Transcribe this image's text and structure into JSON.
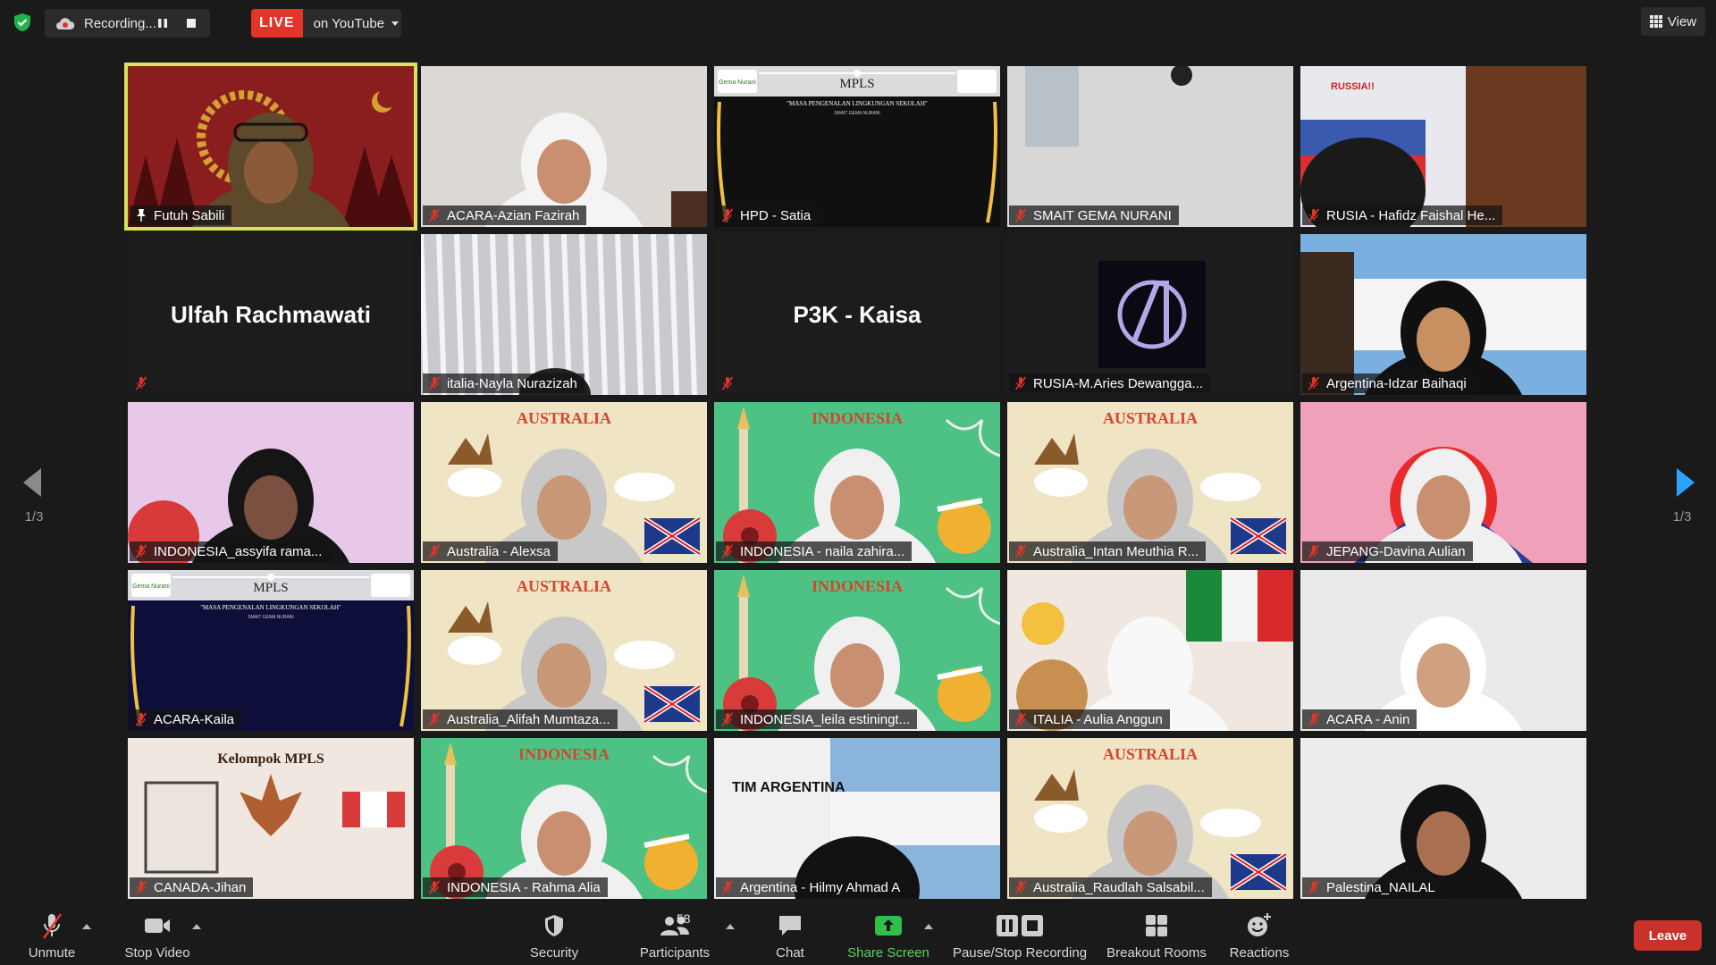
{
  "topbar": {
    "recording_label": "Recording...",
    "live_badge": "LIVE",
    "live_destination": "on YouTube",
    "view_label": "View"
  },
  "paging": {
    "left_label": "1/3",
    "right_label": "1/3"
  },
  "tiles": [
    {
      "name": "Futuh Sabili",
      "active": true,
      "scene": "red"
    },
    {
      "name": "ACARA-Azian Fazirah",
      "scene": "wall"
    },
    {
      "name": "HPD - Satia",
      "scene": "mpls-dark"
    },
    {
      "name": "SMAIT GEMA NURANI",
      "scene": "grey"
    },
    {
      "name": "RUSIA - Hafidz Faishal He...",
      "scene": "russia"
    },
    {
      "name": "",
      "big": "Ulfah Rachmawati",
      "scene": "black"
    },
    {
      "name": "italia-Nayla Nurazizah",
      "scene": "curtain"
    },
    {
      "name": "",
      "big": "P3K - Kaisa",
      "scene": "black"
    },
    {
      "name": "RUSIA-M.Aries Dewangga...",
      "scene": "avengers"
    },
    {
      "name": "Argentina-Idzar Baihaqi",
      "scene": "argentina"
    },
    {
      "name": "INDONESIA_assyifa rama...",
      "scene": "indo-pink"
    },
    {
      "name": "Australia - Alexsa",
      "scene": "australia",
      "banner": "AUSTRALIA"
    },
    {
      "name": "INDONESIA - naila zahira...",
      "scene": "indonesia",
      "banner": "INDONESIA"
    },
    {
      "name": "Australia_Intan Meuthia R...",
      "scene": "australia",
      "banner": "AUSTRALIA"
    },
    {
      "name": "JEPANG-Davina Aulian",
      "scene": "japan"
    },
    {
      "name": "ACARA-Kaila",
      "scene": "mpls-blue"
    },
    {
      "name": "Australia_Alifah Mumtaza...",
      "scene": "australia",
      "banner": "AUSTRALIA"
    },
    {
      "name": "INDONESIA_leila estiningt...",
      "scene": "indonesia",
      "banner": "INDONESIA"
    },
    {
      "name": "ITALIA - Aulia Anggun",
      "scene": "italy"
    },
    {
      "name": "ACARA - Anin",
      "scene": "white"
    },
    {
      "name": "CANADA-Jihan",
      "scene": "canada",
      "banner": "Kelompok MPLS"
    },
    {
      "name": "INDONESIA - Rahma Alia",
      "scene": "indonesia",
      "banner": "INDONESIA"
    },
    {
      "name": "Argentina - Hilmy Ahmad A",
      "scene": "argentina2"
    },
    {
      "name": "Australia_Raudlah Salsabil...",
      "scene": "australia",
      "banner": "AUSTRALIA"
    },
    {
      "name": "Palestina_NAILAL",
      "scene": "white2"
    }
  ],
  "mpls": {
    "title": "MPLS",
    "subtitle": "\"MASA PENGENALAN LINGKUNGAN SEKOLAH\"",
    "school": "SMAIT GEMA NURANI",
    "logo_text": "Gema Nurani"
  },
  "toolbar": {
    "unmute": "Unmute",
    "stop_video": "Stop Video",
    "security": "Security",
    "participants": "Participants",
    "participants_count": "58",
    "chat": "Chat",
    "share_screen": "Share Screen",
    "pause_stop_recording": "Pause/Stop Recording",
    "breakout_rooms": "Breakout Rooms",
    "reactions": "Reactions",
    "leave": "Leave"
  },
  "colors": {
    "active_speaker": "#d7e35a",
    "live_red": "#e5332a",
    "share_green": "#2fbf4a",
    "leave_red": "#c8322b",
    "paging_arrow": "#2aa3ff"
  }
}
